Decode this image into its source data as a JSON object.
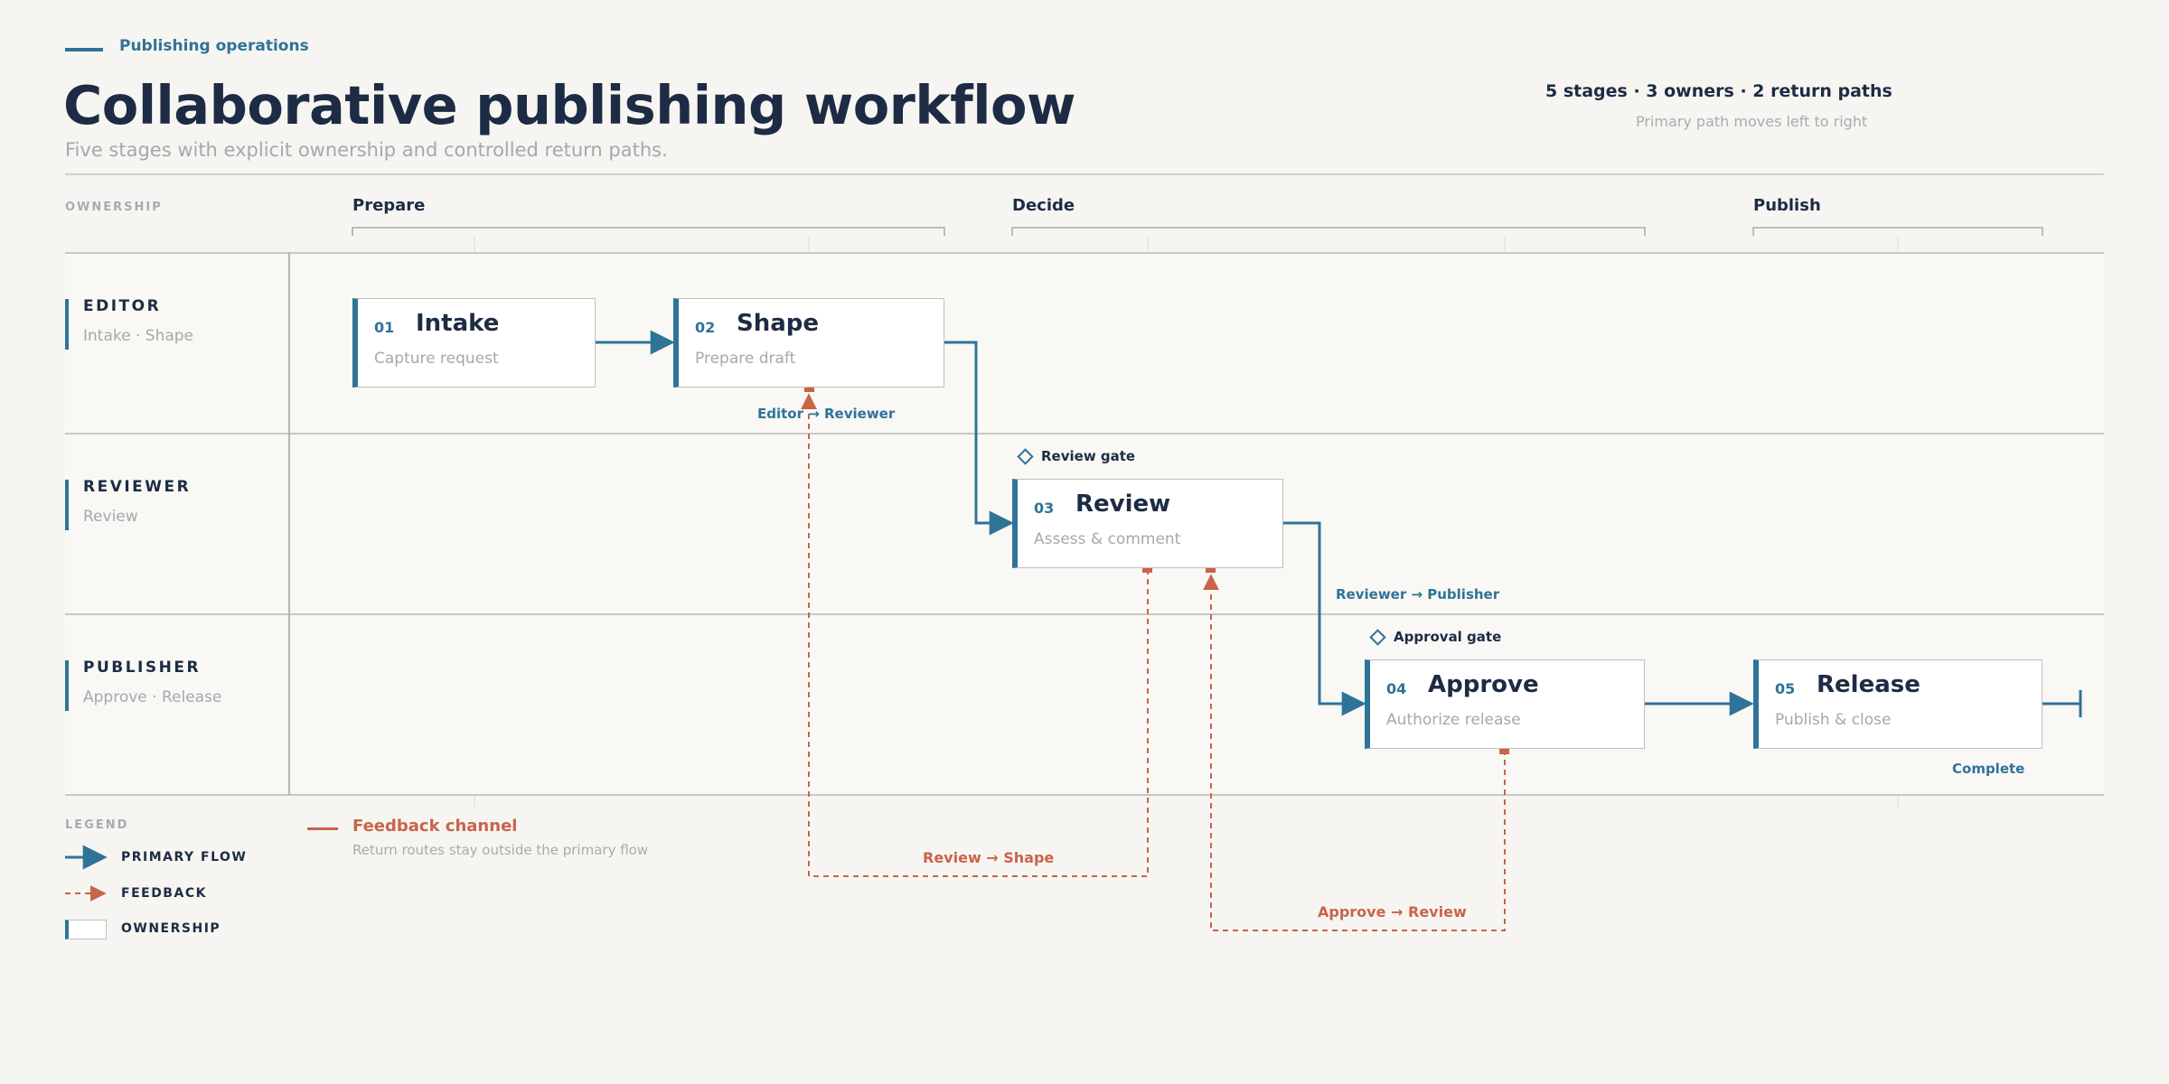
{
  "header": {
    "eyebrow": "Publishing operations",
    "title": "Collaborative publishing workflow",
    "subtitle": "Five stages with explicit ownership and controlled return paths.",
    "summary": "5 stages · 3 owners · 2 return paths",
    "summary_note": "Primary path moves left to right"
  },
  "ownership_label": "OWNERSHIP",
  "phases": [
    "Prepare",
    "Decide",
    "Publish"
  ],
  "lanes": [
    {
      "name": "EDITOR",
      "sub": "Intake · Shape"
    },
    {
      "name": "REVIEWER",
      "sub": "Review"
    },
    {
      "name": "PUBLISHER",
      "sub": "Approve · Release"
    }
  ],
  "stages": [
    {
      "num": "01",
      "name": "Intake",
      "desc": "Capture request"
    },
    {
      "num": "02",
      "name": "Shape",
      "desc": "Prepare draft"
    },
    {
      "num": "03",
      "name": "Review",
      "desc": "Assess & comment"
    },
    {
      "num": "04",
      "name": "Approve",
      "desc": "Authorize release"
    },
    {
      "num": "05",
      "name": "Release",
      "desc": "Publish & close"
    }
  ],
  "gates": {
    "review": "Review gate",
    "approval": "Approval gate"
  },
  "flow_labels": {
    "editor_reviewer": "Editor → Reviewer",
    "reviewer_publisher": "Reviewer → Publisher",
    "complete": "Complete"
  },
  "feedback_labels": {
    "review_shape": "Review → Shape",
    "approve_review": "Approve → Review"
  },
  "legend": {
    "title": "LEGEND",
    "primary": "PRIMARY FLOW",
    "feedback": "FEEDBACK",
    "ownership": "OWNERSHIP",
    "feedback_channel": "Feedback channel",
    "feedback_note": "Return routes stay outside the primary flow"
  },
  "colors": {
    "primary": "#2f7398",
    "feedback": "#c8644a",
    "text": "#1d2b44",
    "muted": "#a5a8ad",
    "background": "#f7f5f1"
  }
}
